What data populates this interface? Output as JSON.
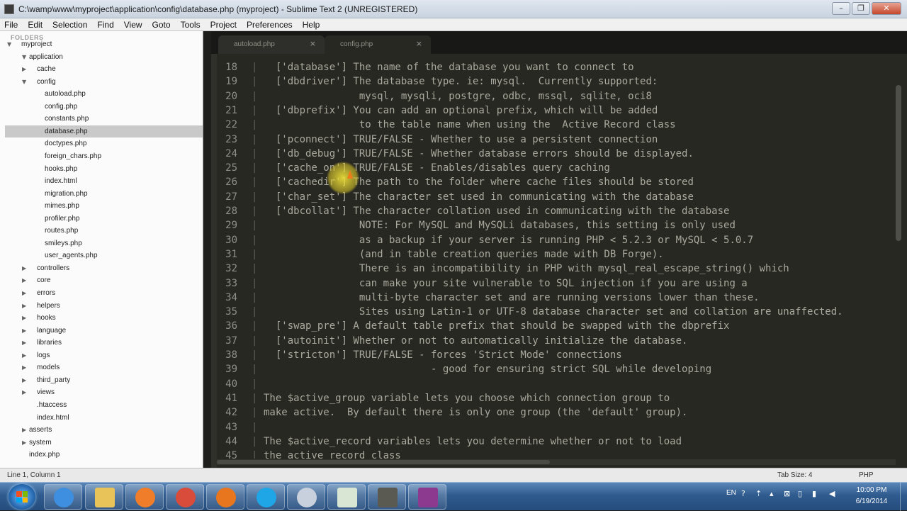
{
  "window": {
    "title": "C:\\wamp\\www\\myproject\\application\\config\\database.php (myproject) - Sublime Text 2 (UNREGISTERED)",
    "buttons": [
      "0",
      "1",
      "r"
    ]
  },
  "menu": [
    "File",
    "Edit",
    "Selection",
    "Find",
    "View",
    "Goto",
    "Tools",
    "Project",
    "Preferences",
    "Help"
  ],
  "sidebar": {
    "header": "FOLDERS",
    "items": [
      {
        "label": "myproject",
        "depth": 0,
        "twisty": "▼"
      },
      {
        "label": "application",
        "depth": 1,
        "twisty": "▼"
      },
      {
        "label": "cache",
        "depth": 2,
        "twisty": "▶"
      },
      {
        "label": "config",
        "depth": 2,
        "twisty": "▼"
      },
      {
        "label": "autoload.php",
        "depth": 3,
        "twisty": ""
      },
      {
        "label": "config.php",
        "depth": 3,
        "twisty": ""
      },
      {
        "label": "constants.php",
        "depth": 3,
        "twisty": ""
      },
      {
        "label": "database.php",
        "depth": 3,
        "twisty": "",
        "selected": true
      },
      {
        "label": "doctypes.php",
        "depth": 3,
        "twisty": ""
      },
      {
        "label": "foreign_chars.php",
        "depth": 3,
        "twisty": ""
      },
      {
        "label": "hooks.php",
        "depth": 3,
        "twisty": ""
      },
      {
        "label": "index.html",
        "depth": 3,
        "twisty": ""
      },
      {
        "label": "migration.php",
        "depth": 3,
        "twisty": ""
      },
      {
        "label": "mimes.php",
        "depth": 3,
        "twisty": ""
      },
      {
        "label": "profiler.php",
        "depth": 3,
        "twisty": ""
      },
      {
        "label": "routes.php",
        "depth": 3,
        "twisty": ""
      },
      {
        "label": "smileys.php",
        "depth": 3,
        "twisty": ""
      },
      {
        "label": "user_agents.php",
        "depth": 3,
        "twisty": ""
      },
      {
        "label": "controllers",
        "depth": 2,
        "twisty": "▶"
      },
      {
        "label": "core",
        "depth": 2,
        "twisty": "▶"
      },
      {
        "label": "errors",
        "depth": 2,
        "twisty": "▶"
      },
      {
        "label": "helpers",
        "depth": 2,
        "twisty": "▶"
      },
      {
        "label": "hooks",
        "depth": 2,
        "twisty": "▶"
      },
      {
        "label": "language",
        "depth": 2,
        "twisty": "▶"
      },
      {
        "label": "libraries",
        "depth": 2,
        "twisty": "▶"
      },
      {
        "label": "logs",
        "depth": 2,
        "twisty": "▶"
      },
      {
        "label": "models",
        "depth": 2,
        "twisty": "▶"
      },
      {
        "label": "third_party",
        "depth": 2,
        "twisty": "▶"
      },
      {
        "label": "views",
        "depth": 2,
        "twisty": "▶"
      },
      {
        "label": ".htaccess",
        "depth": 2,
        "twisty": ""
      },
      {
        "label": "index.html",
        "depth": 2,
        "twisty": ""
      },
      {
        "label": "asserts",
        "depth": 1,
        "twisty": "▶"
      },
      {
        "label": "system",
        "depth": 1,
        "twisty": "▶"
      },
      {
        "label": "index.php",
        "depth": 1,
        "twisty": ""
      }
    ]
  },
  "tabs": [
    {
      "label": "autoload.php",
      "close": "×",
      "active": false
    },
    {
      "label": "config.php",
      "close": "×",
      "active": true
    }
  ],
  "code_lines": [
    {
      "n": "18",
      "g": "|",
      "t": "  ['database'] The name of the database you want to connect to"
    },
    {
      "n": "19",
      "g": "|",
      "t": "  ['dbdriver'] The database type. ie: mysql.  Currently supported:"
    },
    {
      "n": "20",
      "g": "|",
      "t": "                mysql, mysqli, postgre, odbc, mssql, sqlite, oci8"
    },
    {
      "n": "21",
      "g": "|",
      "t": "  ['dbprefix'] You can add an optional prefix, which will be added"
    },
    {
      "n": "22",
      "g": "|",
      "t": "                to the table name when using the  Active Record class"
    },
    {
      "n": "23",
      "g": "|",
      "t": "  ['pconnect'] TRUE/FALSE - Whether to use a persistent connection"
    },
    {
      "n": "24",
      "g": "|",
      "t": "  ['db_debug'] TRUE/FALSE - Whether database errors should be displayed."
    },
    {
      "n": "25",
      "g": "|",
      "t": "  ['cache_on'] TRUE/FALSE - Enables/disables query caching"
    },
    {
      "n": "26",
      "g": "|",
      "t": "  ['cachedir'] The path to the folder where cache files should be stored"
    },
    {
      "n": "27",
      "g": "|",
      "t": "  ['char_set'] The character set used in communicating with the database"
    },
    {
      "n": "28",
      "g": "|",
      "t": "  ['dbcollat'] The character collation used in communicating with the database"
    },
    {
      "n": "29",
      "g": "|",
      "t": "                NOTE: For MySQL and MySQLi databases, this setting is only used"
    },
    {
      "n": "30",
      "g": "|",
      "t": "                as a backup if your server is running PHP < 5.2.3 or MySQL < 5.0.7"
    },
    {
      "n": "31",
      "g": "|",
      "t": "                (and in table creation queries made with DB Forge)."
    },
    {
      "n": "32",
      "g": "|",
      "t": "                There is an incompatibility in PHP with mysql_real_escape_string() which"
    },
    {
      "n": "33",
      "g": "|",
      "t": "                can make your site vulnerable to SQL injection if you are using a"
    },
    {
      "n": "34",
      "g": "|",
      "t": "                multi-byte character set and are running versions lower than these."
    },
    {
      "n": "35",
      "g": "|",
      "t": "                Sites using Latin-1 or UTF-8 database character set and collation are unaffected."
    },
    {
      "n": "36",
      "g": "|",
      "t": "  ['swap_pre'] A default table prefix that should be swapped with the dbprefix"
    },
    {
      "n": "37",
      "g": "|",
      "t": "  ['autoinit'] Whether or not to automatically initialize the database."
    },
    {
      "n": "38",
      "g": "|",
      "t": "  ['stricton'] TRUE/FALSE - forces 'Strict Mode' connections"
    },
    {
      "n": "39",
      "g": "|",
      "t": "                            - good for ensuring strict SQL while developing"
    },
    {
      "n": "40",
      "g": "|",
      "t": ""
    },
    {
      "n": "41",
      "g": "|",
      "t": "The $active_group variable lets you choose which connection group to"
    },
    {
      "n": "42",
      "g": "|",
      "t": "make active.  By default there is only one group (the 'default' group)."
    },
    {
      "n": "43",
      "g": "|",
      "t": ""
    },
    {
      "n": "44",
      "g": "|",
      "t": "The $active_record variables lets you determine whether or not to load"
    },
    {
      "n": "45",
      "g": "|",
      "t": "the active record class"
    }
  ],
  "status": {
    "position": "Line 1, Column 1",
    "tab_size": "Tab Size: 4",
    "syntax": "PHP"
  },
  "taskbar": {
    "apps": [
      {
        "name": "internet-explorer-icon",
        "color": "#3f8fe0"
      },
      {
        "name": "folder-icon",
        "color": "#e8c35a"
      },
      {
        "name": "media-player-icon",
        "color": "#f07d2a"
      },
      {
        "name": "chrome-icon",
        "color": "#d94b3b"
      },
      {
        "name": "firefox-icon",
        "color": "#e8761f"
      },
      {
        "name": "skype-icon",
        "color": "#1ea6e6"
      },
      {
        "name": "gauge-icon",
        "color": "#c8d0de"
      },
      {
        "name": "notepad-icon",
        "color": "#d9e6d4"
      },
      {
        "name": "sublime-text-icon",
        "color": "#5a5a52"
      },
      {
        "name": "winrar-icon",
        "color": "#8b3a8f"
      }
    ],
    "lang": "EN",
    "time": "10:00 PM",
    "date": "6/19/2014"
  }
}
